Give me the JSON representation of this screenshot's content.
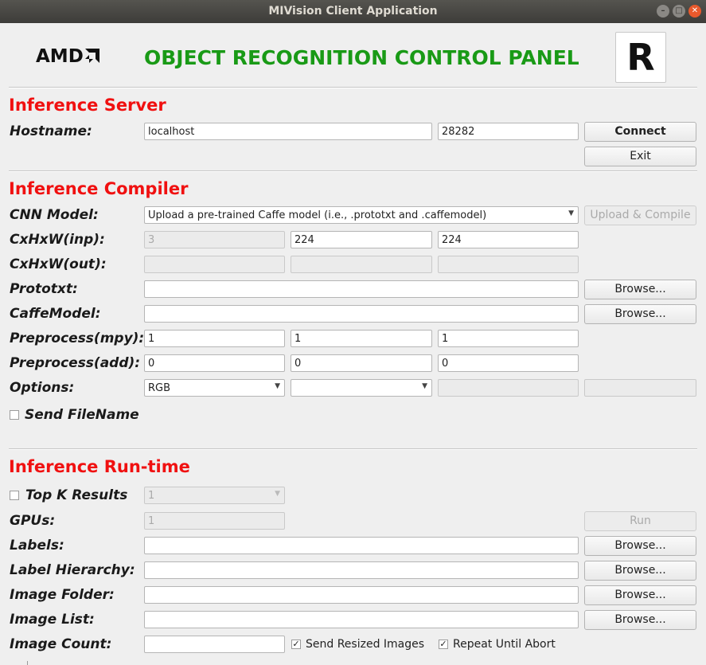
{
  "window": {
    "title": "MIVision Client Application"
  },
  "header": {
    "brand": "AMD",
    "panel_title": "OBJECT RECOGNITION CONTROL PANEL",
    "logo_letter": "R"
  },
  "server": {
    "section": "Inference Server",
    "hostname_label": "Hostname:",
    "hostname_value": "localhost",
    "port_value": "28282",
    "connect_label": "Connect",
    "exit_label": "Exit"
  },
  "compiler": {
    "section": "Inference Compiler",
    "cnn_label": "CNN Model:",
    "cnn_selected": "Upload a pre-trained Caffe model (i.e., .prototxt and .caffemodel)",
    "upload_label": "Upload & Compile",
    "inp_label": "CxHxW(inp):",
    "inp_c": "3",
    "inp_h": "224",
    "inp_w": "224",
    "out_label": "CxHxW(out):",
    "out_c": "",
    "out_h": "",
    "out_w": "",
    "prototxt_label": "Prototxt:",
    "prototxt_value": "",
    "caffemodel_label": "CaffeModel:",
    "caffemodel_value": "",
    "browse_label": "Browse...",
    "mpy_label": "Preprocess(mpy):",
    "mpy_1": "1",
    "mpy_2": "1",
    "mpy_3": "1",
    "add_label": "Preprocess(add):",
    "add_1": "0",
    "add_2": "0",
    "add_3": "0",
    "options_label": "Options:",
    "option_1": "RGB",
    "option_2": "",
    "option_3": "",
    "option_4": "",
    "send_filename_label": "Send FileName",
    "send_filename_checked": ""
  },
  "runtime": {
    "section": "Inference Run-time",
    "topk_label": "Top K Results",
    "topk_checked": "",
    "topk_value": "1",
    "gpus_label": "GPUs:",
    "gpus_value": "1",
    "run_label": "Run",
    "labels_label": "Labels:",
    "labels_value": "",
    "hierarchy_label": "Label Hierarchy:",
    "hierarchy_value": "",
    "folder_label": "Image Folder:",
    "folder_value": "",
    "list_label": "Image List:",
    "list_value": "",
    "count_label": "Image Count:",
    "count_value": "",
    "browse_label": "Browse...",
    "send_resized_label": "Send Resized Images",
    "send_resized_checked": "✓",
    "repeat_label": "Repeat Until Abort",
    "repeat_checked": "✓"
  }
}
